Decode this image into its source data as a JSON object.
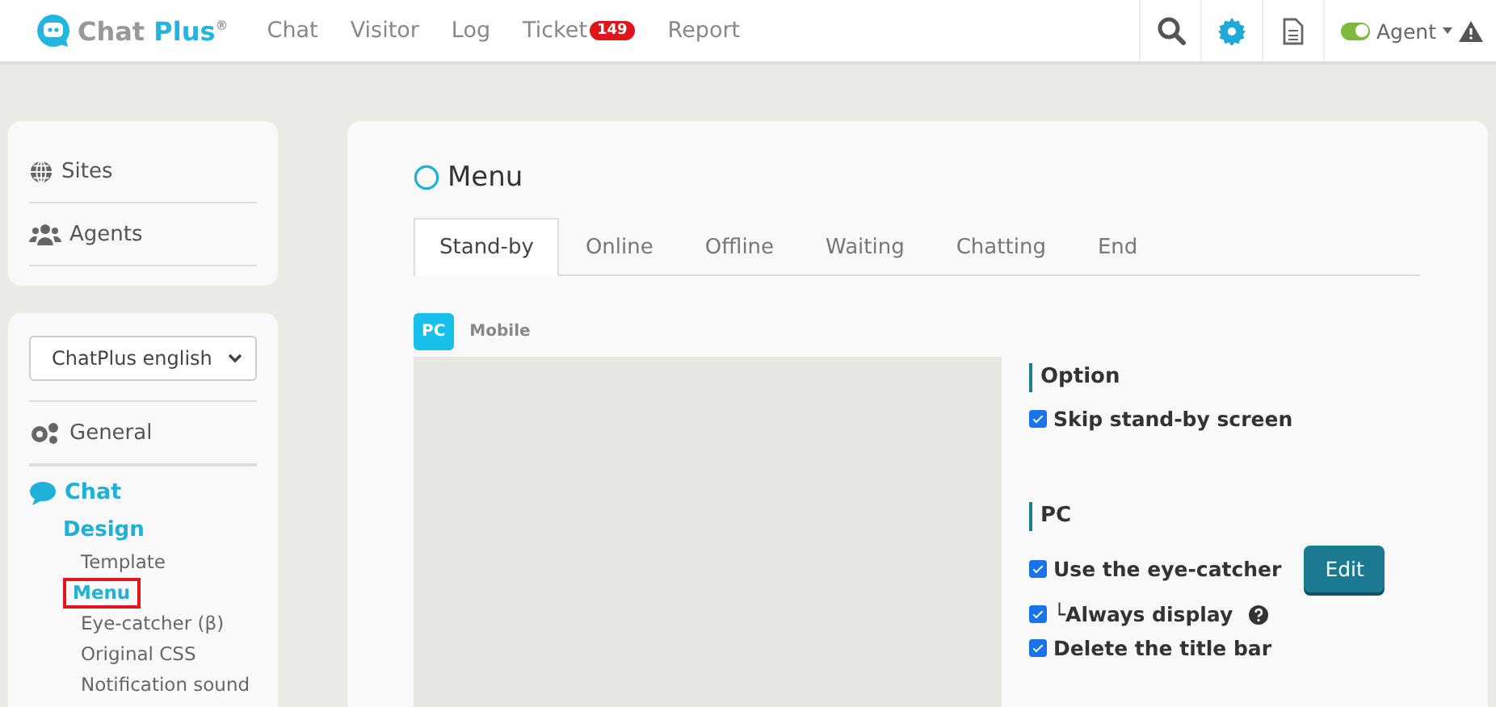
{
  "header": {
    "logo": {
      "name": "Chat",
      "accent": "Plus",
      "mark": "®"
    },
    "nav": [
      {
        "label": "Chat"
      },
      {
        "label": "Visitor"
      },
      {
        "label": "Log"
      },
      {
        "label": "Ticket",
        "badge": "149"
      },
      {
        "label": "Report"
      }
    ],
    "agent": {
      "label": "Agent",
      "on": true
    }
  },
  "sidebar": {
    "top_items": [
      {
        "label": "Sites",
        "kind": "globe"
      },
      {
        "label": "Agents",
        "kind": "users"
      }
    ],
    "site_select": {
      "value": "ChatPlus english"
    },
    "general": {
      "label": "General"
    },
    "chat": {
      "label": "Chat"
    },
    "design": {
      "label": "Design"
    },
    "design_items": [
      {
        "label": "Template",
        "selected": false
      },
      {
        "label": "Menu",
        "selected": true
      },
      {
        "label": "Eye-catcher (β)",
        "selected": false
      },
      {
        "label": "Original CSS",
        "selected": false
      },
      {
        "label": "Notification sound",
        "selected": false
      }
    ]
  },
  "main": {
    "title": "Menu",
    "tabs": [
      {
        "label": "Stand-by",
        "selected": true
      },
      {
        "label": "Online",
        "selected": false
      },
      {
        "label": "Offline",
        "selected": false
      },
      {
        "label": "Waiting",
        "selected": false
      },
      {
        "label": "Chatting",
        "selected": false
      },
      {
        "label": "End",
        "selected": false
      }
    ],
    "devices": [
      {
        "label": "PC",
        "selected": true
      },
      {
        "label": "Mobile",
        "selected": false
      }
    ],
    "sections": [
      {
        "heading": "Option",
        "options": [
          {
            "label": "Skip stand-by screen",
            "checked": true
          }
        ]
      },
      {
        "heading": "PC",
        "options": [
          {
            "label": "Use the eye-catcher",
            "checked": true,
            "button": "Edit"
          },
          {
            "label": "└Always display",
            "checked": true,
            "help": true
          },
          {
            "label": "Delete the title bar",
            "checked": true
          }
        ]
      }
    ]
  }
}
